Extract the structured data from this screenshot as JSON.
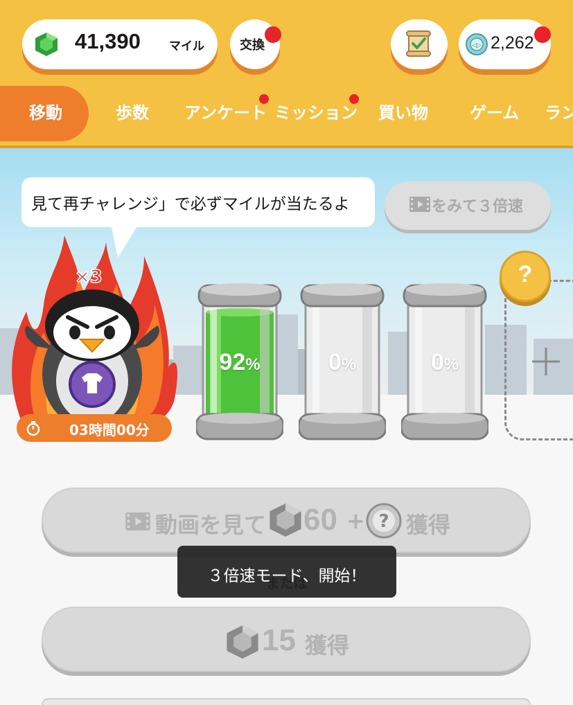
{
  "header": {
    "miles_value": "41,390",
    "miles_unit": "マイル",
    "exchange_label": "交換",
    "coin_value": "2,262",
    "colors": {
      "background": "#f5c143",
      "accent": "#ee7d2c",
      "badge": "#e8232c"
    }
  },
  "tabs": [
    {
      "label": "移動",
      "active": true
    },
    {
      "label": "歩数",
      "active": false
    },
    {
      "label": "アンケート",
      "active": false,
      "badge": true
    },
    {
      "label": "ミッション",
      "active": false,
      "badge": true
    },
    {
      "label": "買い物",
      "active": false
    },
    {
      "label": "ゲーム",
      "active": false
    },
    {
      "label": "ラン",
      "active": false
    }
  ],
  "scene": {
    "speech": "見て再チャレンジ」で必ずマイルが当たるよ",
    "speed_button_label": "をみて３倍速",
    "multiplier": "×3",
    "timer": "03時間00分",
    "canisters": [
      {
        "value": "92",
        "unit": "%",
        "fill": 0.92
      },
      {
        "value": "0",
        "unit": "%",
        "fill": 0
      },
      {
        "value": "0",
        "unit": "%",
        "fill": 0
      }
    ],
    "question_mark": "?"
  },
  "actions": {
    "video_button": {
      "prefix": "動画を見て",
      "amount": "60",
      "plus": "+",
      "suffix": "獲得"
    },
    "or_label": "または",
    "claim_button": {
      "amount": "15",
      "suffix": "獲得"
    }
  },
  "toast": "３倍速モード、開始！"
}
